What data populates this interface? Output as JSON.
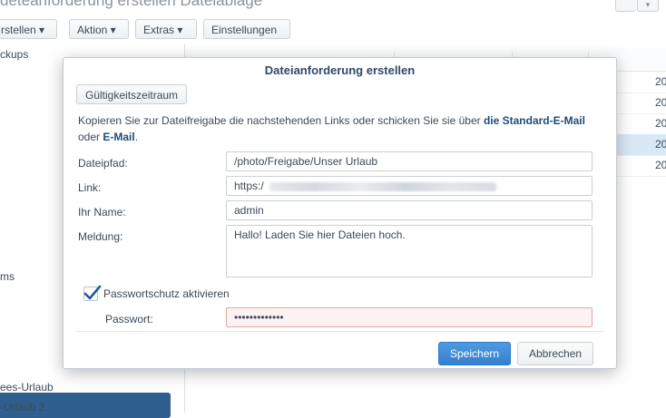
{
  "page": {
    "window_title_fragment": "deteanforderung erstellen Dateiablage"
  },
  "toolbar": {
    "buttons": [
      {
        "label": "rstellen ▾"
      },
      {
        "label": "Aktion ▾"
      },
      {
        "label": "Extras ▾"
      },
      {
        "label": "Einstellungen"
      }
    ],
    "right_control": "▾"
  },
  "sidebar": {
    "items": [
      {
        "label": "ckups"
      },
      {
        "label": "ms"
      },
      {
        "label": "ees-Urlaub"
      },
      {
        "label": "-Urlaub 2"
      }
    ]
  },
  "grid": {
    "rows": [
      {
        "value": "20"
      },
      {
        "value": "20"
      },
      {
        "value": "20"
      },
      {
        "value": "20"
      },
      {
        "value": "20"
      }
    ]
  },
  "dialog": {
    "title": "Dateianforderung erstellen",
    "tab_label": "Gültigkeitszeitraum",
    "description": {
      "part1": "Kopieren Sie zur Dateifreigabe die nachstehenden Links oder schicken Sie sie über ",
      "link1": "die Standard-E-Mail",
      "part2": " oder ",
      "link2": "E-Mail",
      "part3": "."
    },
    "fields": {
      "path_label": "Dateipfad:",
      "path_value": "/photo/Freigabe/Unser Urlaub",
      "link_label": "Link:",
      "link_value": "https:/",
      "name_label": "Ihr Name:",
      "name_value": "admin",
      "message_label": "Meldung:",
      "message_value": "Hallo! Laden Sie hier Dateien hoch."
    },
    "password": {
      "checkbox_label": "Passwortschutz aktivieren",
      "checked": true,
      "label": "Passwort:",
      "value": "•••••••••••••"
    },
    "buttons": {
      "save": "Speichern",
      "cancel": "Abbrechen"
    }
  }
}
